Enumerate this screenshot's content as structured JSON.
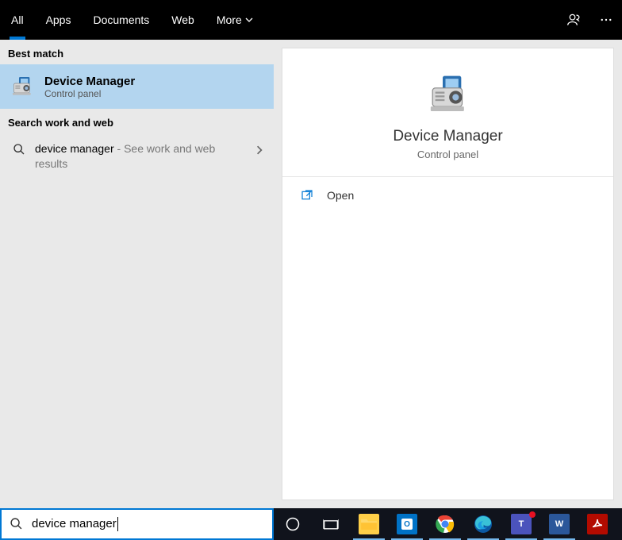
{
  "topbar": {
    "tabs": [
      "All",
      "Apps",
      "Documents",
      "Web",
      "More"
    ],
    "active": 0
  },
  "left": {
    "best_match_label": "Best match",
    "best_match": {
      "title": "Device Manager",
      "subtitle": "Control panel"
    },
    "section2_label": "Search work and web",
    "web_result": {
      "query": "device manager",
      "suffix": " - See work and web results"
    }
  },
  "detail": {
    "title": "Device Manager",
    "subtitle": "Control panel",
    "actions": {
      "open": "Open"
    }
  },
  "search": {
    "query": "device manager"
  },
  "taskbar": {
    "apps": [
      {
        "name": "file-explorer",
        "bg": "#ffcf48",
        "label": ""
      },
      {
        "name": "outlook",
        "bg": "#0072c6",
        "label": "O"
      },
      {
        "name": "chrome",
        "bg": "#fff",
        "label": ""
      },
      {
        "name": "edge",
        "bg": "#0c59a4",
        "label": ""
      },
      {
        "name": "teams",
        "bg": "#4b53bc",
        "label": "T"
      },
      {
        "name": "word",
        "bg": "#2b579a",
        "label": "W"
      },
      {
        "name": "acrobat",
        "bg": "#b30b00",
        "label": ""
      }
    ]
  }
}
